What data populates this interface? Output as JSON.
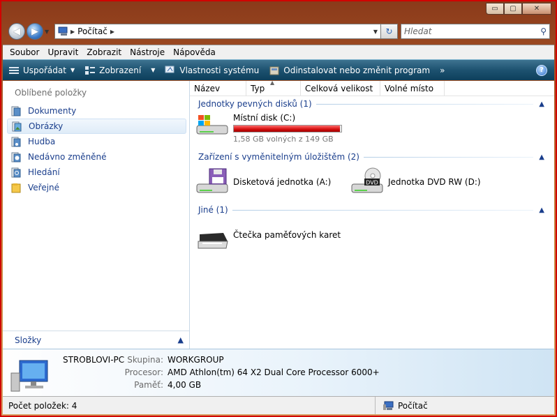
{
  "window": {
    "caption_buttons": {
      "minimize": "▭",
      "maximize": "▢",
      "close": "✕"
    },
    "address": {
      "crumbs": [
        "Počítač"
      ]
    },
    "search": {
      "placeholder": "Hledat"
    }
  },
  "menu": [
    "Soubor",
    "Upravit",
    "Zobrazit",
    "Nástroje",
    "Nápověda"
  ],
  "commands": [
    {
      "label": "Uspořádat",
      "icon": "organize-icon",
      "has_menu": true
    },
    {
      "label": "Zobrazení",
      "icon": "views-icon",
      "has_menu": true
    },
    {
      "label": "Vlastnosti systému",
      "icon": "system-properties-icon",
      "has_menu": false
    },
    {
      "label": "Odinstalovat nebo změnit program",
      "icon": "uninstall-icon",
      "has_menu": false
    }
  ],
  "more_chevron": "»",
  "help_label": "?",
  "sidebar": {
    "header": "Oblíbené položky",
    "items": [
      {
        "label": "Dokumenty",
        "icon": "documents-icon",
        "selected": false
      },
      {
        "label": "Obrázky",
        "icon": "pictures-icon",
        "selected": true
      },
      {
        "label": "Hudba",
        "icon": "music-icon",
        "selected": false
      },
      {
        "label": "Nedávno změněné",
        "icon": "recent-icon",
        "selected": false
      },
      {
        "label": "Hledání",
        "icon": "searches-icon",
        "selected": false
      },
      {
        "label": "Veřejné",
        "icon": "public-folder-icon",
        "selected": false
      }
    ],
    "folders_label": "Složky"
  },
  "columns": [
    "Název",
    "Typ",
    "Celková velikost",
    "Volné místo"
  ],
  "groups": {
    "hdd": {
      "title": "Jednotky pevných disků (1)",
      "items": [
        {
          "label": "Místní disk (C:)",
          "free_text": "1,58 GB volných z 149 GB",
          "used_fraction": 0.989
        }
      ]
    },
    "removable": {
      "title": "Zařízení s vyměnitelným úložištěm (2)",
      "items": [
        {
          "label": "Disketová jednotka (A:)"
        },
        {
          "label": "Jednotka DVD RW (D:)",
          "badge": "DVD"
        }
      ]
    },
    "other": {
      "title": "Jiné (1)",
      "items": [
        {
          "label": "Čtečka paměťových karet"
        }
      ]
    }
  },
  "details": {
    "pc_name": "STROBLOVI-PC",
    "rows": [
      {
        "key": "Skupina:",
        "value": "WORKGROUP"
      },
      {
        "key": "Procesor:",
        "value": "AMD Athlon(tm) 64 X2 Dual Core Processor 6000+"
      },
      {
        "key": "Paměť:",
        "value": "4,00 GB"
      }
    ]
  },
  "status": {
    "count": "Počet položek: 4",
    "location": "Počítač"
  },
  "colors": {
    "accent_link": "#1a3e8c",
    "cmdbar": "#1d5270",
    "disk_bar": "#d40e0e"
  }
}
